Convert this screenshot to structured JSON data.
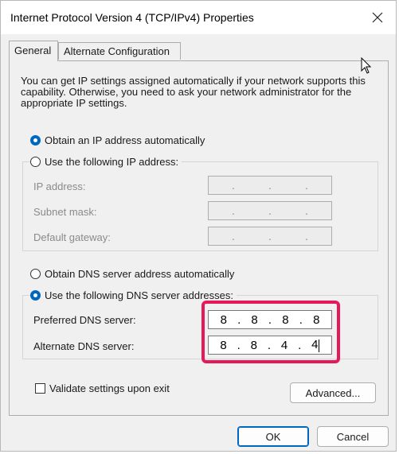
{
  "window": {
    "title": "Internet Protocol Version 4 (TCP/IPv4) Properties"
  },
  "tabs": [
    {
      "label": "General",
      "active": true
    },
    {
      "label": "Alternate Configuration",
      "active": false
    }
  ],
  "info_text": "You can get IP settings assigned automatically if your network supports this capability. Otherwise, you need to ask your network administrator for the appropriate IP settings.",
  "ip_mode": {
    "auto_label": "Obtain an IP address automatically",
    "manual_label": "Use the following IP address:",
    "selected": "auto"
  },
  "ip_fields": {
    "ip_address_label": "IP address:",
    "subnet_mask_label": "Subnet mask:",
    "default_gateway_label": "Default gateway:",
    "separator": "."
  },
  "dns_mode": {
    "auto_label": "Obtain DNS server address automatically",
    "manual_label": "Use the following DNS server addresses:",
    "selected": "manual"
  },
  "dns_fields": {
    "preferred_label": "Preferred DNS server:",
    "preferred_octets": [
      "8",
      "8",
      "8",
      "8"
    ],
    "alternate_label": "Alternate DNS server:",
    "alternate_octets": [
      "8",
      "8",
      "4",
      "4"
    ],
    "separator": "."
  },
  "validate": {
    "label": "Validate settings upon exit",
    "checked": false
  },
  "buttons": {
    "advanced": "Advanced...",
    "ok": "OK",
    "cancel": "Cancel"
  },
  "colors": {
    "accent": "#0067c0",
    "highlight": "#e6185a"
  },
  "icons": {
    "close": "close-icon",
    "cursor": "mouse-pointer-icon"
  }
}
